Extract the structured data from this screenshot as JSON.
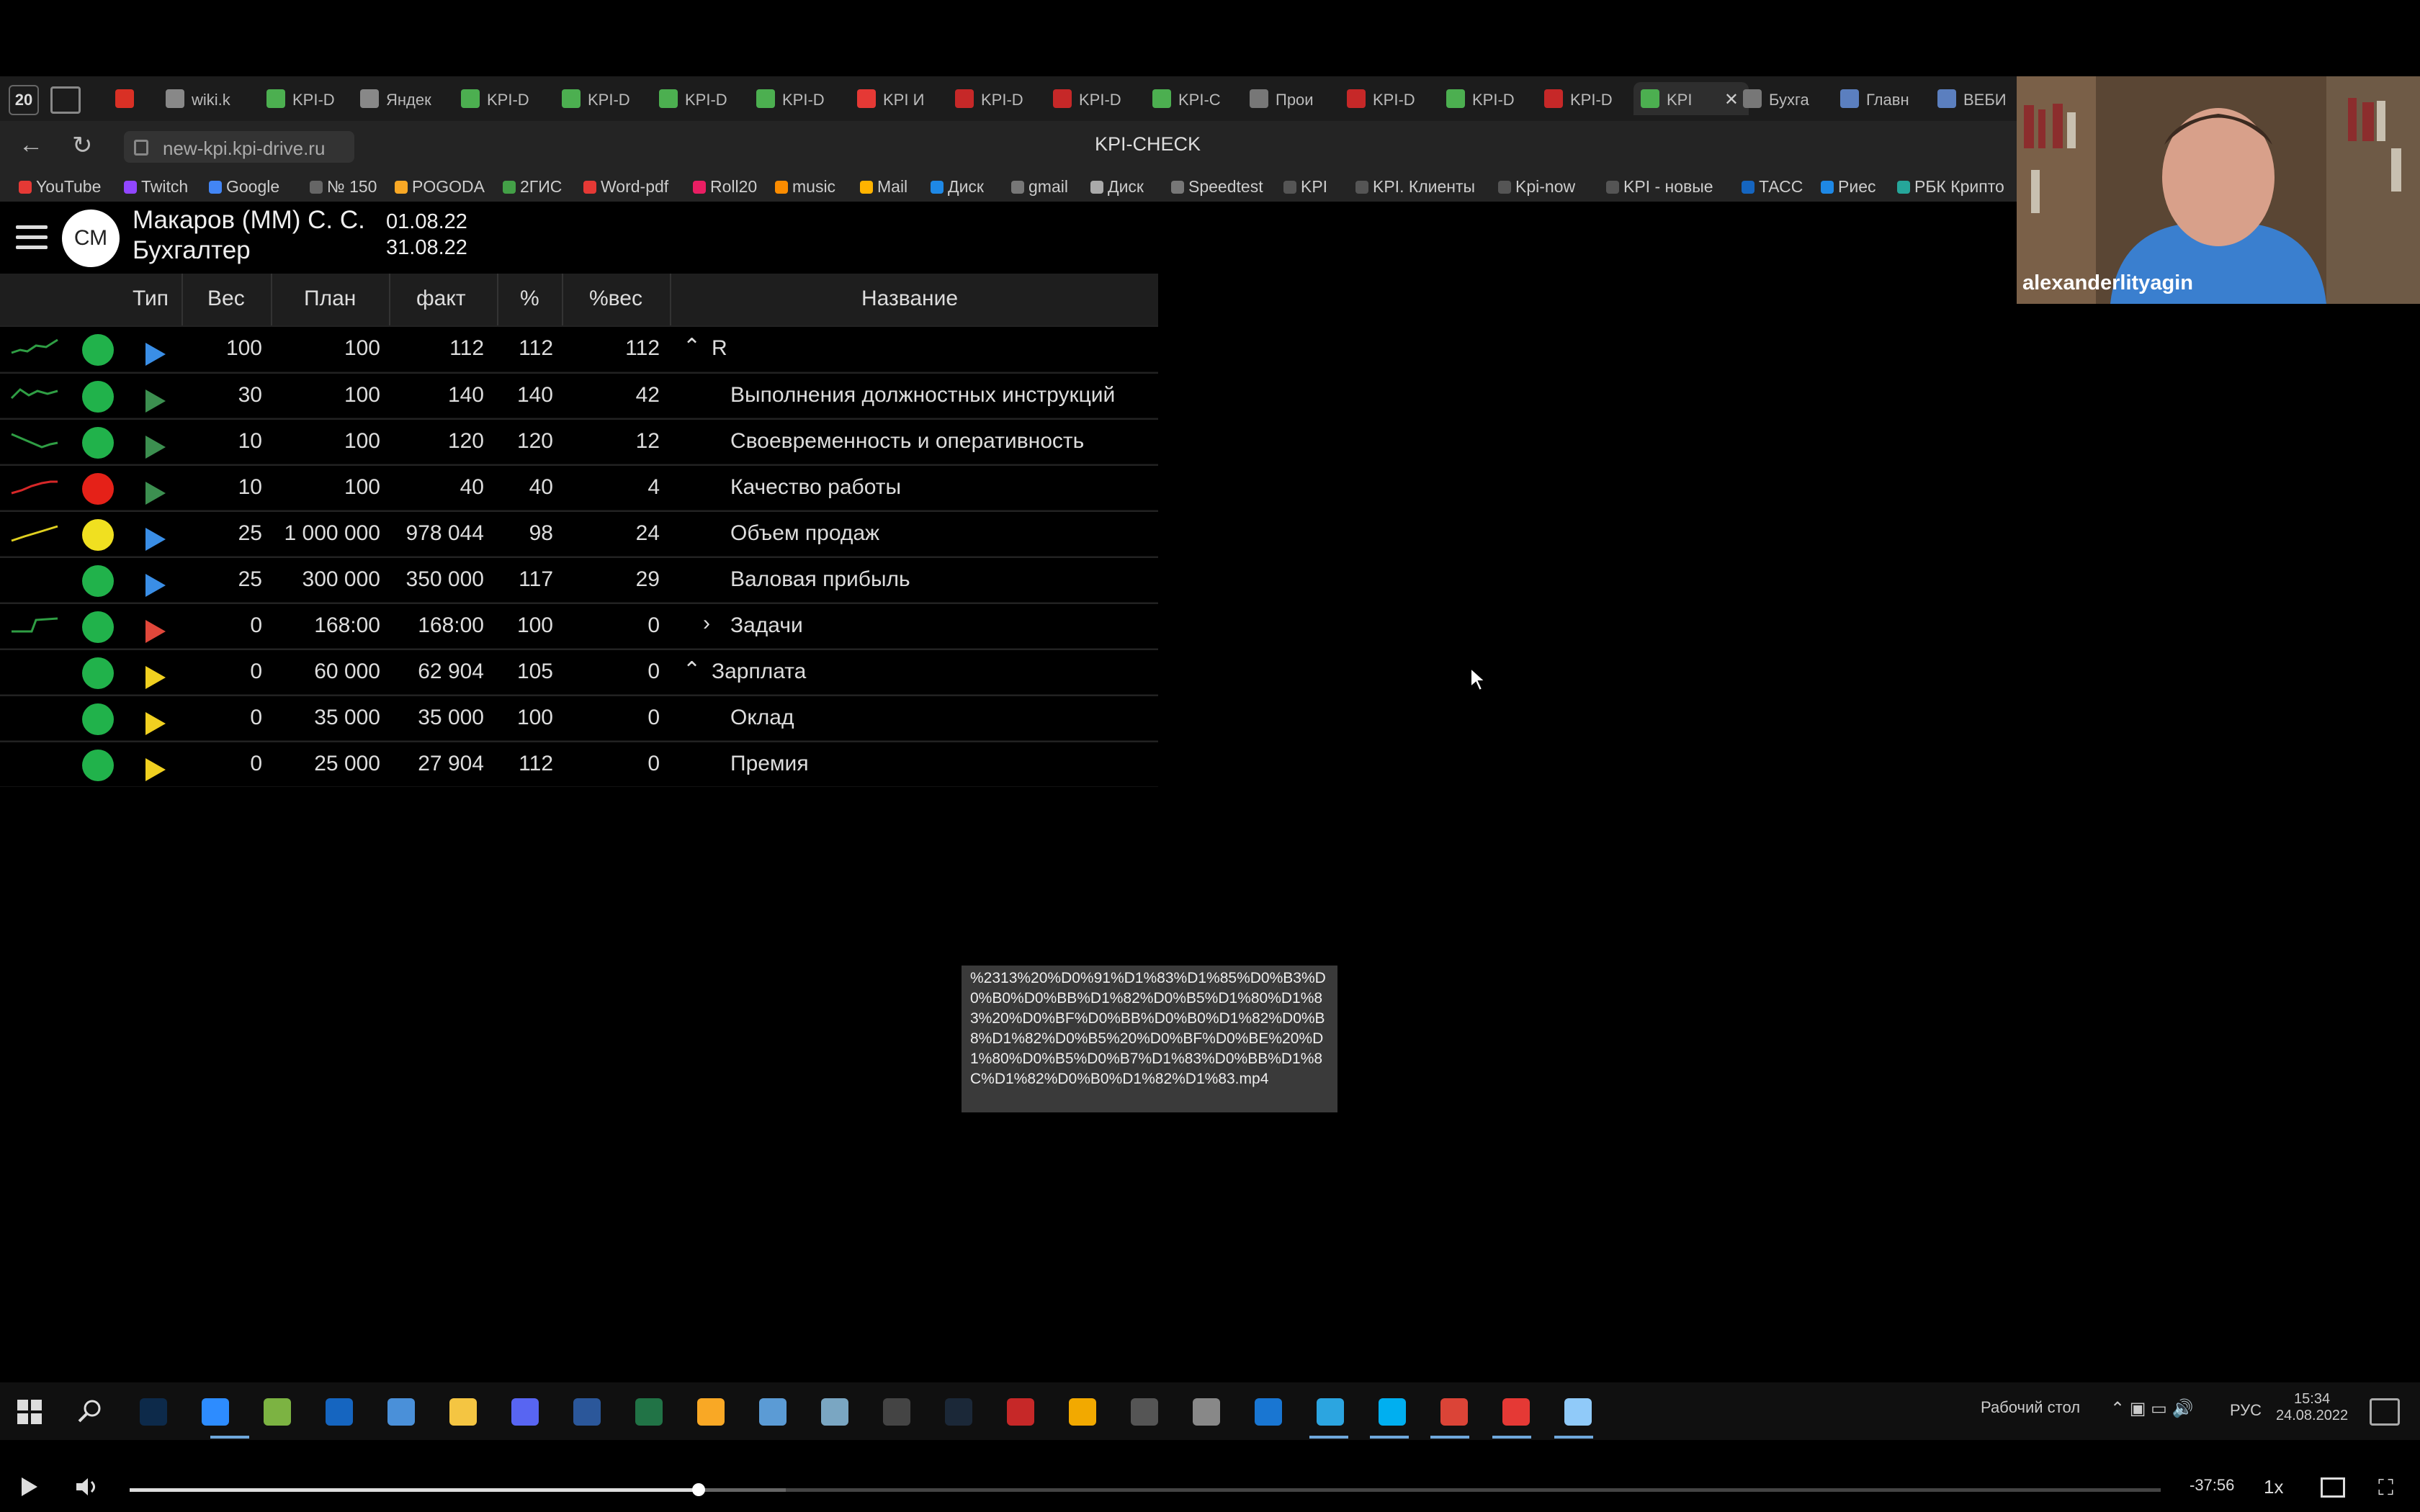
{
  "browser": {
    "tab_count": "20",
    "tabs": [
      {
        "label": "",
        "color": "#d93025"
      },
      {
        "label": "wiki.k",
        "color": "#888"
      },
      {
        "label": "KPI-D",
        "color": "#4caf50"
      },
      {
        "label": "Яндек",
        "color": "#888"
      },
      {
        "label": "KPI-D",
        "color": "#4caf50"
      },
      {
        "label": "KPI-D",
        "color": "#4caf50"
      },
      {
        "label": "KPI-D",
        "color": "#4caf50"
      },
      {
        "label": "KPI-D",
        "color": "#4caf50"
      },
      {
        "label": "KPI И",
        "color": "#e53935"
      },
      {
        "label": "KPI-D",
        "color": "#c62828"
      },
      {
        "label": "KPI-D",
        "color": "#c62828"
      },
      {
        "label": "KPI-C",
        "color": "#4caf50"
      },
      {
        "label": "Прои",
        "color": "#777"
      },
      {
        "label": "KPI-D",
        "color": "#c62828"
      },
      {
        "label": "KPI-D",
        "color": "#4caf50"
      },
      {
        "label": "KPI-D",
        "color": "#c62828"
      },
      {
        "label": "KPI",
        "color": "#4caf50"
      },
      {
        "label": "Бухга",
        "color": "#777"
      },
      {
        "label": "Главн",
        "color": "#5b7fbf"
      },
      {
        "label": "ВЕБИ",
        "color": "#5b7fbf"
      }
    ],
    "url": "new-kpi.kpi-drive.ru",
    "page_title": "KPI-CHECK",
    "bookmarks": [
      {
        "label": "YouTube",
        "color": "#e53935"
      },
      {
        "label": "Twitch",
        "color": "#9146ff"
      },
      {
        "label": "Google",
        "color": "#4285f4"
      },
      {
        "label": "№ 150",
        "color": "#666"
      },
      {
        "label": "POGODA",
        "color": "#f9a825"
      },
      {
        "label": "2ГИС",
        "color": "#43a047"
      },
      {
        "label": "Word-pdf",
        "color": "#e53935"
      },
      {
        "label": "Roll20",
        "color": "#e91e63"
      },
      {
        "label": "music",
        "color": "#fb8c00"
      },
      {
        "label": "Mail",
        "color": "#ffb300"
      },
      {
        "label": "Диск",
        "color": "#1e88e5"
      },
      {
        "label": "gmail",
        "color": "#777"
      },
      {
        "label": "Диск",
        "color": "#aaa"
      },
      {
        "label": "Speedtest",
        "color": "#777"
      },
      {
        "label": "KPI",
        "color": "#555"
      },
      {
        "label": "KPI. Клиенты",
        "color": "#555"
      },
      {
        "label": "Kpi-now",
        "color": "#555"
      },
      {
        "label": "KPI - новые",
        "color": "#555"
      },
      {
        "label": "ТАСС",
        "color": "#1565c0"
      },
      {
        "label": "Риес",
        "color": "#1e88e5"
      },
      {
        "label": "РБК Крипто",
        "color": "#26a69a"
      }
    ]
  },
  "app": {
    "avatar_initials": "СМ",
    "user_name": "Макаров (ММ) С. С.",
    "user_role": "Бухгалтер",
    "date_from": "01.08.22",
    "date_to": "31.08.22"
  },
  "table": {
    "headers": {
      "type": "Тип",
      "weight": "Вес",
      "plan": "План",
      "fact": "факт",
      "percent": "%",
      "percent_weight": "%вес",
      "name": "Название"
    },
    "rows": [
      {
        "trend": "up-green",
        "status": "#21b24b",
        "arrow": "#3a8ee6",
        "weight": "100",
        "plan": "100",
        "fact": "112",
        "percent": "112",
        "pw": "112",
        "name": "R",
        "chevron": "up",
        "indent": 0
      },
      {
        "trend": "wave-green",
        "status": "#21b24b",
        "arrow": "#3c8f50",
        "weight": "30",
        "plan": "100",
        "fact": "140",
        "percent": "140",
        "pw": "42",
        "name": "Выполнения должностных инструкций",
        "chevron": "",
        "indent": 1
      },
      {
        "trend": "down-green",
        "status": "#21b24b",
        "arrow": "#3c8f50",
        "weight": "10",
        "plan": "100",
        "fact": "120",
        "percent": "120",
        "pw": "12",
        "name": "Своевременность и оперативность",
        "chevron": "",
        "indent": 1
      },
      {
        "trend": "up-red",
        "status": "#e52118",
        "arrow": "#3c8f50",
        "weight": "10",
        "plan": "100",
        "fact": "40",
        "percent": "40",
        "pw": "4",
        "name": "Качество работы",
        "chevron": "",
        "indent": 1
      },
      {
        "trend": "up-yellow",
        "status": "#f0e020",
        "arrow": "#3a8ee6",
        "weight": "25",
        "plan": "1 000 000",
        "fact": "978 044",
        "percent": "98",
        "pw": "24",
        "name": "Объем продаж",
        "chevron": "",
        "indent": 1
      },
      {
        "trend": "",
        "status": "#21b24b",
        "arrow": "#3a8ee6",
        "weight": "25",
        "plan": "300 000",
        "fact": "350 000",
        "percent": "117",
        "pw": "29",
        "name": "Валовая прибыль",
        "chevron": "",
        "indent": 1
      },
      {
        "trend": "step-green",
        "status": "#21b24b",
        "arrow": "#e0473a",
        "weight": "0",
        "plan": "168:00",
        "fact": "168:00",
        "percent": "100",
        "pw": "0",
        "name": "Задачи",
        "chevron": "right",
        "indent": 0
      },
      {
        "trend": "",
        "status": "#21b24b",
        "arrow": "#f0d020",
        "weight": "0",
        "plan": "60 000",
        "fact": "62 904",
        "percent": "105",
        "pw": "0",
        "name": "Зарплата",
        "chevron": "up",
        "indent": 0
      },
      {
        "trend": "",
        "status": "#21b24b",
        "arrow": "#f0d020",
        "weight": "0",
        "plan": "35 000",
        "fact": "35 000",
        "percent": "100",
        "pw": "0",
        "name": "Оклад",
        "chevron": "",
        "indent": 1
      },
      {
        "trend": "",
        "status": "#21b24b",
        "arrow": "#f0d020",
        "weight": "0",
        "plan": "25 000",
        "fact": "27 904",
        "percent": "112",
        "pw": "0",
        "name": "Премия",
        "chevron": "",
        "indent": 1
      }
    ]
  },
  "webcam": {
    "name": "alexanderlityagin"
  },
  "tooltip": {
    "text": "%2313%20%D0%91%D1%83%D1%85%D0%B3%D0%B0%D0%BB%D1%82%D0%B5%D1%80%D1%83%20%D0%BF%D0%BB%D0%B0%D1%82%D0%B8%D1%82%D0%B5%20%D0%BF%D0%BE%20%D1%80%D0%B5%D0%B7%D1%83%D0%BB%D1%8C%D1%82%D0%B0%D1%82%D1%83.mp4"
  },
  "taskbar": {
    "desktop_label": "Рабочий стол",
    "lang": "РУС",
    "time": "15:34",
    "date": "24.08.2022",
    "apps": [
      {
        "name": "windows-start-icon",
        "color": "#ddd"
      },
      {
        "name": "search-icon",
        "color": "#ddd"
      },
      {
        "name": "photoshop-icon",
        "color": "#0d2a4a"
      },
      {
        "name": "zoom-icon",
        "color": "#2d8cff"
      },
      {
        "name": "utorrent-icon",
        "color": "#7cb342"
      },
      {
        "name": "visio-icon",
        "color": "#1565c0"
      },
      {
        "name": "app-icon",
        "color": "#4a90d9"
      },
      {
        "name": "explorer-icon",
        "color": "#f4c542"
      },
      {
        "name": "discord-icon",
        "color": "#5865f2"
      },
      {
        "name": "word-icon",
        "color": "#2b579a"
      },
      {
        "name": "excel-icon",
        "color": "#217346"
      },
      {
        "name": "app-icon",
        "color": "#f9a825"
      },
      {
        "name": "app-icon",
        "color": "#5b9bd5"
      },
      {
        "name": "app-icon",
        "color": "#7aa6c2"
      },
      {
        "name": "obs-icon",
        "color": "#444"
      },
      {
        "name": "steam-icon",
        "color": "#1b2838"
      },
      {
        "name": "app-icon",
        "color": "#c62828"
      },
      {
        "name": "app-icon",
        "color": "#f2a900"
      },
      {
        "name": "app-icon",
        "color": "#555"
      },
      {
        "name": "app-icon",
        "color": "#888"
      },
      {
        "name": "snip-icon",
        "color": "#1976d2"
      },
      {
        "name": "telegram-icon",
        "color": "#2ca5e0"
      },
      {
        "name": "skype-icon",
        "color": "#00aff0"
      },
      {
        "name": "chrome-icon",
        "color": "#db4437"
      },
      {
        "name": "yandex-browser-icon",
        "color": "#e53935"
      },
      {
        "name": "app-icon",
        "color": "#90caf9"
      }
    ]
  },
  "player": {
    "remaining": "-37:56",
    "speed": "1x",
    "progress": 0.28,
    "buffered": 0.323
  }
}
